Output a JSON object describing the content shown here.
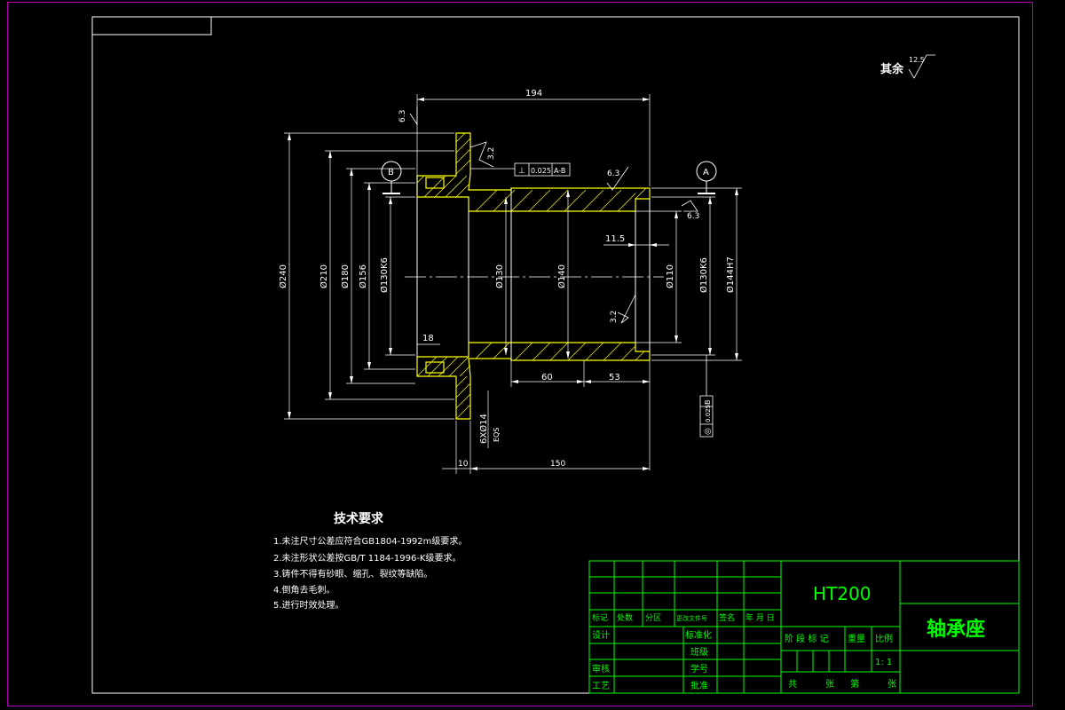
{
  "drawing": {
    "dims": {
      "d194": "194",
      "d240": "Ø240",
      "d210": "Ø210",
      "d180": "Ø180",
      "d156": "Ø156",
      "d130k6_left": "Ø130K6",
      "d130": "Ø130",
      "d140": "Ø140",
      "d110": "Ø110",
      "d130k6_right": "Ø130K6",
      "d144h7": "Ø144H7",
      "d11_5": "11.5",
      "d18": "18",
      "d60": "60",
      "d53": "53",
      "d10": "10",
      "d150": "150",
      "holes": "6XØ14",
      "eqs": "EQS"
    },
    "roughness": {
      "r63_left": "6.3",
      "r32_flange": "3.2",
      "r63_top": "6.3",
      "r63_right": "6.3",
      "r32_bore": "3.2",
      "rest_label": "其余",
      "rest_value": "12.5"
    },
    "datums": {
      "a": "A",
      "b": "B"
    },
    "tolerance_perp": {
      "symbol": "⊥",
      "value": "0.025",
      "ref": "A-B"
    },
    "tolerance_runout": {
      "symbol": "◎",
      "value": "0.025",
      "ref": "B"
    }
  },
  "tech_requirements": {
    "title": "技术要求",
    "items": [
      "1.未注尺寸公差应符合GB1804-1992m级要求。",
      "2.未注形状公差按GB/T 1184-1996-K级要求。",
      "3.铸件不得有砂眼、缩孔、裂纹等缺陷。",
      "4.倒角去毛刺。",
      "5.进行时效处理。"
    ]
  },
  "title_block": {
    "material": "HT200",
    "part_name": "轴承座",
    "header_row": [
      "标记",
      "处数",
      "分区",
      "更改文件号",
      "签名",
      "年 月 日"
    ],
    "design": "设计",
    "standardize": "标准化",
    "review": "审核",
    "process": "工艺",
    "class_label": "班级",
    "student_id": "学号",
    "approve": "批准",
    "stage_mark": "阶 段 标 记",
    "weight": "重量",
    "scale_label": "比例",
    "scale_value": "1: 1",
    "sheets_total": "共",
    "sheets_unit": "张",
    "sheet_no": "第",
    "sheet_unit2": "张"
  },
  "colors": {
    "outline": "#ffffff",
    "section_fill": "#ffff00",
    "dimension": "#ffffff",
    "title_grid": "#00ff00",
    "title_text": "#00ff00",
    "sheet_border": "#b000b0"
  }
}
